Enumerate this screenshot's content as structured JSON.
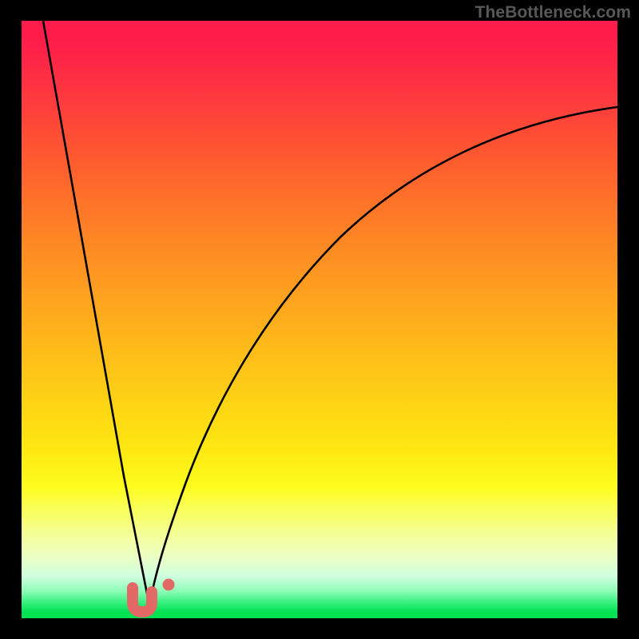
{
  "watermark": "TheBottleneck.com",
  "chart_data": {
    "type": "line",
    "title": "",
    "xlabel": "",
    "ylabel": "",
    "xlim": [
      0,
      1
    ],
    "ylim": [
      0,
      1
    ],
    "background_gradient": {
      "top": "#fe1c4b",
      "bottom": "#01e253",
      "meaning": "red=high bottleneck, green=low bottleneck"
    },
    "curve_minimum": {
      "x": 0.215,
      "y": 0.0
    },
    "curve_description": "V-shaped bottleneck curve: bottleneck falls from 1.0 at x≈0 to 0.0 at x≈0.22, then rises asymptotically toward ~0.83 at x=1.0",
    "series": [
      {
        "name": "bottleneck-curve",
        "x": [
          0.0,
          0.04,
          0.08,
          0.12,
          0.16,
          0.2,
          0.215,
          0.23,
          0.24,
          0.28,
          0.33,
          0.4,
          0.5,
          0.6,
          0.7,
          0.8,
          0.9,
          1.0
        ],
        "values": [
          1.0,
          0.8,
          0.6,
          0.41,
          0.22,
          0.05,
          0.0,
          0.05,
          0.08,
          0.2,
          0.32,
          0.45,
          0.58,
          0.67,
          0.73,
          0.78,
          0.81,
          0.83
        ]
      }
    ],
    "markers": [
      {
        "name": "marker-left",
        "x": 0.195,
        "y": 0.015,
        "shape": "u-blob",
        "color": "#e26966"
      },
      {
        "name": "marker-right",
        "x": 0.246,
        "y": 0.035,
        "shape": "dot",
        "color": "#e26966"
      }
    ]
  }
}
